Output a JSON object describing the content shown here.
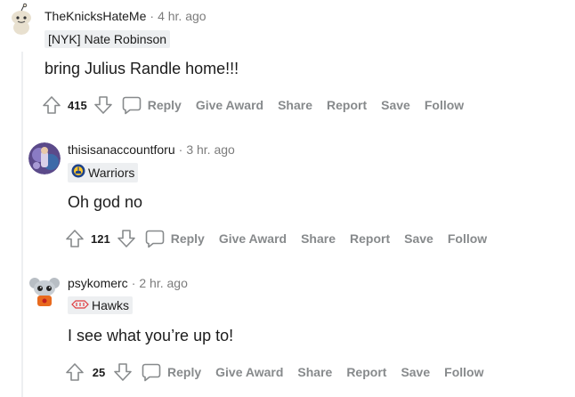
{
  "comments": [
    {
      "author": "TheKnicksHateMe",
      "time": "4 hr. ago",
      "flair": "[NYK] Nate Robinson",
      "body": "bring Julius Randle home!!!",
      "score": "415",
      "avatar": "snoo-avatar-icon"
    },
    {
      "author": "thisisanaccountforu",
      "time": "3 hr. ago",
      "flair": "Warriors",
      "flair_icon": "warriors-logo-icon",
      "body": "Oh god no",
      "score": "121",
      "avatar": "user-avatar-icon"
    },
    {
      "author": "psykomerc",
      "time": "2 hr. ago",
      "flair": "Hawks",
      "flair_icon": "hawks-logo-icon",
      "body": "I see what you’re up to!",
      "score": "25",
      "avatar": "snoo-avatar-icon"
    }
  ],
  "separator": "·",
  "actions": {
    "reply": "Reply",
    "give_award": "Give Award",
    "share": "Share",
    "report": "Report",
    "save": "Save",
    "follow": "Follow"
  },
  "colors": {
    "text": "#1c1c1c",
    "muted": "#7c7c7c",
    "action": "#878a8c",
    "flair_bg": "#edeff1",
    "thread_line": "#edeff1"
  }
}
